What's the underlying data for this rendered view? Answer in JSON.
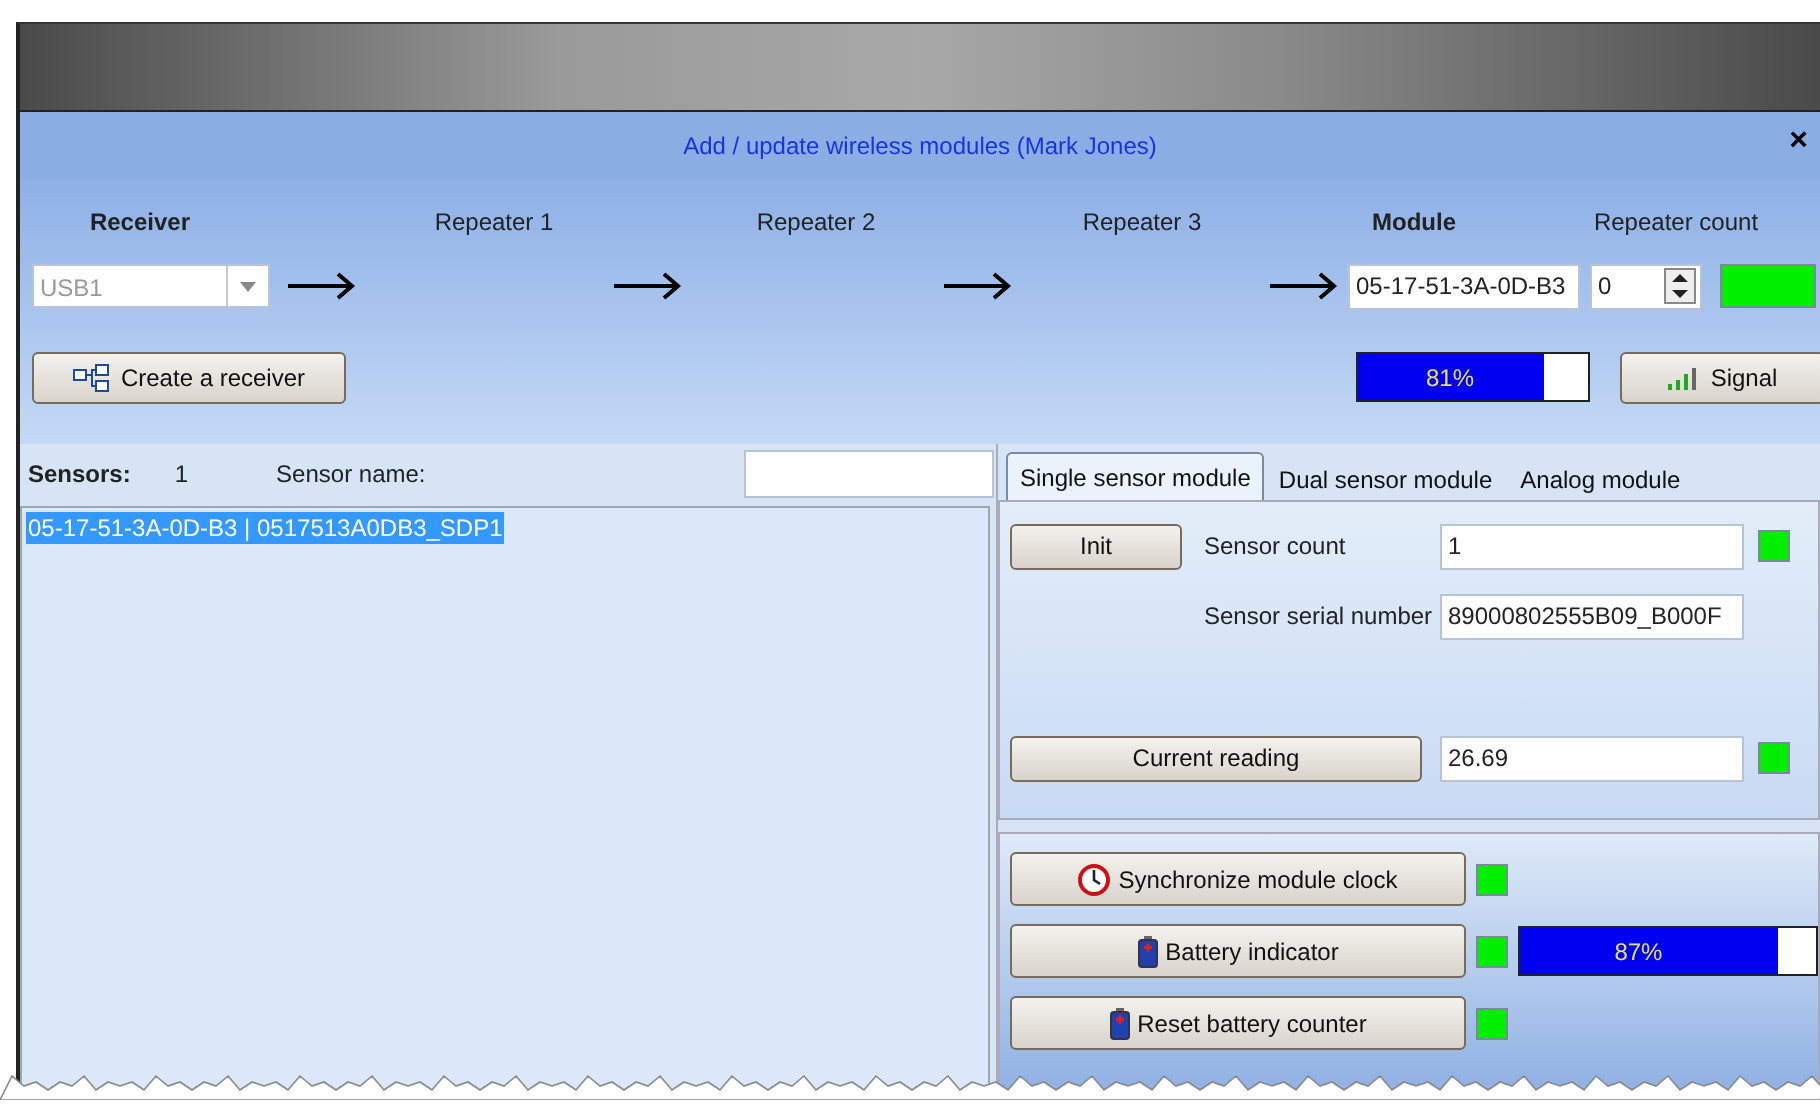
{
  "window": {
    "title": "Add / update wireless modules (Mark Jones)",
    "close": "×"
  },
  "route": {
    "columns": [
      {
        "label": "Receiver",
        "bold": true
      },
      {
        "label": "Repeater 1",
        "bold": false
      },
      {
        "label": "Repeater 2",
        "bold": false
      },
      {
        "label": "Repeater 3",
        "bold": false
      },
      {
        "label": "Module",
        "bold": true
      },
      {
        "label": "Repeater count",
        "bold": false
      }
    ],
    "receiver": {
      "value": "USB1",
      "disabled": true
    },
    "module": {
      "value": "05-17-51-3A-0D-B3"
    },
    "repeater_count": {
      "value": "0"
    },
    "link_ok": true,
    "create_receiver_button": "Create a receiver",
    "signal": {
      "level": 0.81,
      "reading": "81%"
    },
    "signal_button": "Signal"
  },
  "sensors": {
    "label": "Sensors:",
    "count": "1",
    "name_label": "Sensor name:",
    "items": [
      {
        "text": "05-17-51-3A-0D-B3 | 0517513A0DB3_SDP1",
        "selected": true
      }
    ]
  },
  "tabs": [
    {
      "label": "Single sensor module",
      "selected": true
    },
    {
      "label": "Dual sensor module",
      "selected": false
    },
    {
      "label": "Analog module",
      "selected": false
    }
  ],
  "single": {
    "init_button": "Init",
    "sensor_count_label": "Sensor count",
    "sensor_count": "1",
    "sensor_count_ok": true,
    "serial_label": "Sensor serial number",
    "serial": "89000802555B09_B000F",
    "reading_button": "Current reading",
    "reading": "26.69",
    "reading_ok": true
  },
  "actions": [
    {
      "label": "Synchronize module clock",
      "kind": "clock",
      "ok": true
    },
    {
      "label": "Battery indicator",
      "kind": "battery",
      "ok": true,
      "level": 0.87,
      "reading": "87%"
    },
    {
      "label": "Reset battery counter",
      "kind": "battery",
      "ok": true
    }
  ]
}
